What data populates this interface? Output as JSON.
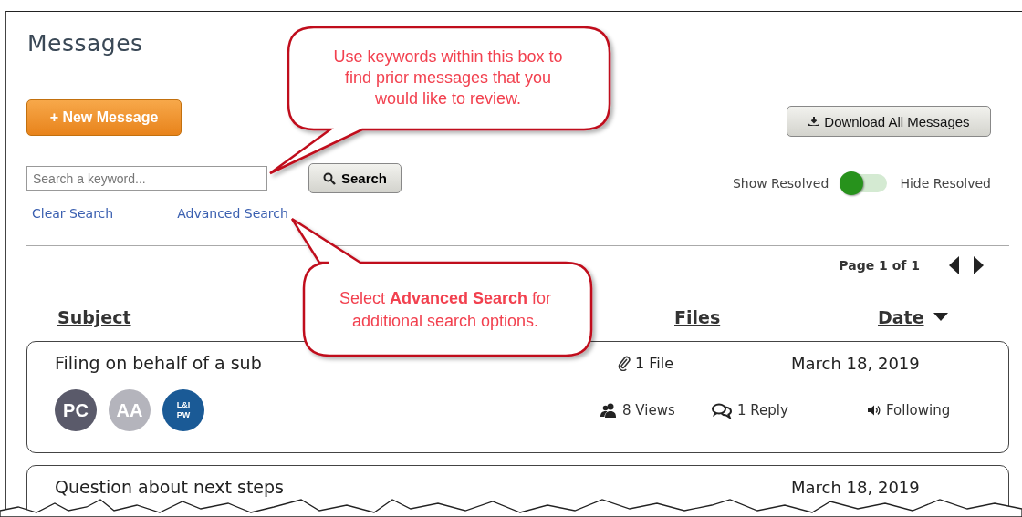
{
  "page": {
    "title": "Messages"
  },
  "new_message_button": "+ New Message",
  "download_button": "Download All Messages",
  "search": {
    "placeholder": "Search a keyword...",
    "button": "Search"
  },
  "links": [
    "Clear Search",
    "Advanced Search"
  ],
  "resolved_toggle": {
    "left_label": "Show Resolved",
    "right_label": "Hide Resolved",
    "hide_resolved": false
  },
  "pagination": {
    "label": "Page 1 of 1"
  },
  "columns": [
    {
      "label": "Subject",
      "sorted": false
    },
    {
      "label": "Files",
      "sorted": false
    },
    {
      "label": "Date",
      "sorted": true
    }
  ],
  "messages": [
    {
      "subject": "Filing on behalf of a sub",
      "files": "1 File",
      "date": "March 18, 2019",
      "participants": [
        {
          "initials": "PC",
          "kind": "initials",
          "color": "#5a5a6a"
        },
        {
          "initials": "AA",
          "kind": "initials",
          "color": "#b4b4bc"
        },
        {
          "initials": "L&I PW",
          "kind": "logo",
          "color": "#1a5a96"
        }
      ],
      "views": "8 Views",
      "replies": "1 Reply",
      "following": "Following"
    },
    {
      "subject": "Question about next steps",
      "date": "March 18, 2019"
    }
  ],
  "callouts": [
    {
      "text": "Use keywords within this box to find prior messages that you would like to review."
    },
    {
      "text": "Select **Advanced Search** for additional search options."
    }
  ]
}
